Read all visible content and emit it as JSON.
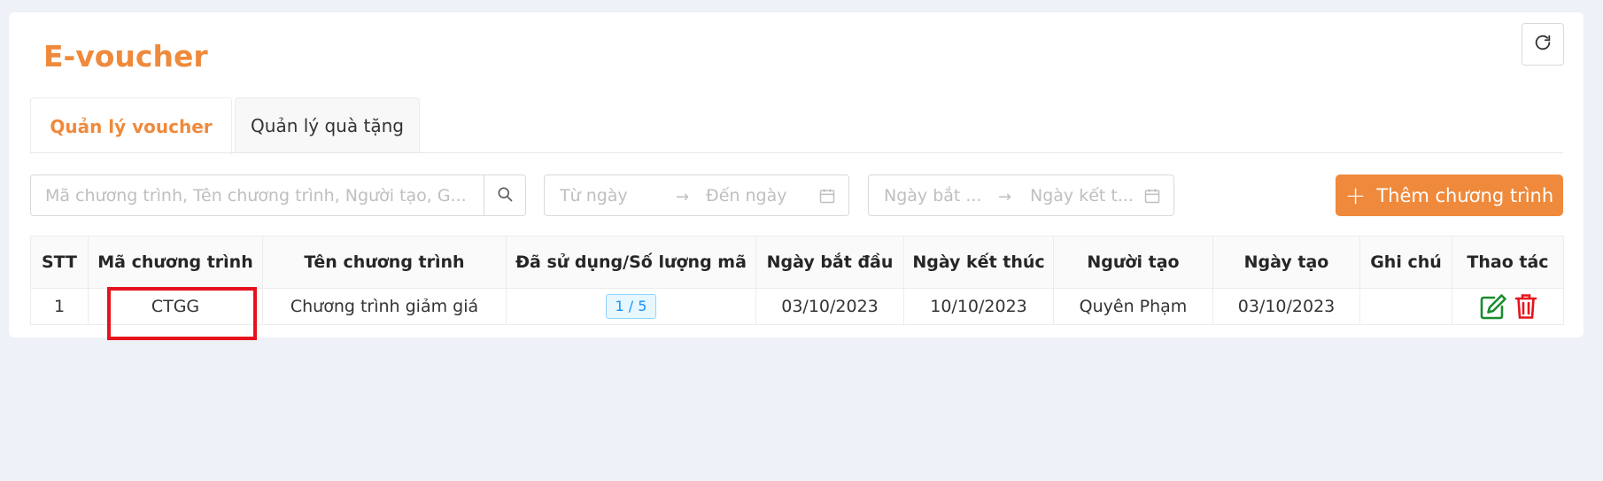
{
  "page": {
    "title": "E-voucher"
  },
  "tabs": [
    {
      "label": "Quản lý voucher",
      "active": true
    },
    {
      "label": "Quản lý quà tặng",
      "active": false
    }
  ],
  "filters": {
    "search_placeholder": "Mã chương trình, Tên chương trình, Người tạo, G...",
    "created_range": {
      "from": "Từ ngày",
      "to": "Đến ngày"
    },
    "program_range": {
      "from": "Ngày bắt ...",
      "to": "Ngày kết t..."
    },
    "separator": "→"
  },
  "add_button": {
    "label": "Thêm chương trình"
  },
  "table": {
    "columns": [
      "STT",
      "Mã chương trình",
      "Tên chương trình",
      "Đã sử dụng/Số lượng mã",
      "Ngày bắt đầu",
      "Ngày kết thúc",
      "Người tạo",
      "Ngày tạo",
      "Ghi chú",
      "Thao tác"
    ],
    "rows": [
      {
        "stt": "1",
        "code": "CTGG",
        "name": "Chương trình giảm giá",
        "usage": "1 / 5",
        "start": "03/10/2023",
        "end": "10/10/2023",
        "creator": "Quyên Phạm",
        "created": "03/10/2023",
        "note": ""
      }
    ]
  },
  "icons": {
    "refresh": "refresh-icon",
    "search": "search-icon",
    "calendar": "calendar-icon",
    "plus": "plus-icon",
    "edit": "edit-icon",
    "delete": "trash-icon"
  },
  "colors": {
    "accent": "#ef8a3c",
    "edit": "#1a8c2e",
    "delete": "#e5141c",
    "highlight": "#e5141c",
    "badge": "#1890ff"
  }
}
